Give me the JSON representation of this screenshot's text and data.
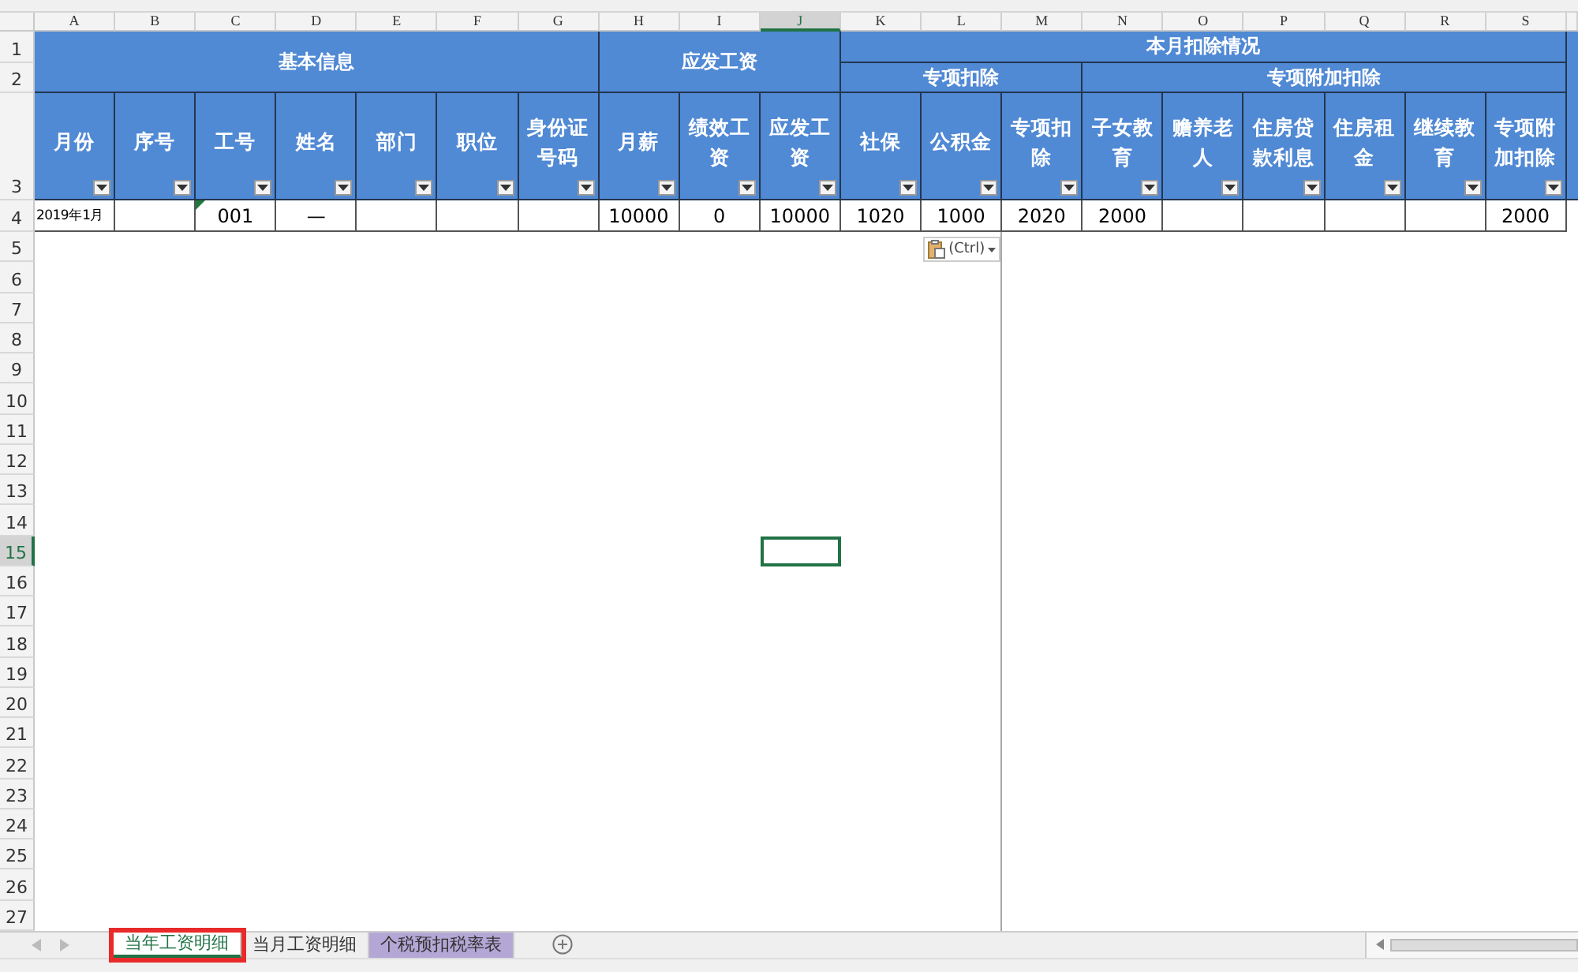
{
  "columns": [
    {
      "label": "A",
      "selected": false
    },
    {
      "label": "B",
      "selected": false
    },
    {
      "label": "C",
      "selected": false
    },
    {
      "label": "D",
      "selected": false
    },
    {
      "label": "E",
      "selected": false
    },
    {
      "label": "F",
      "selected": false
    },
    {
      "label": "G",
      "selected": false
    },
    {
      "label": "H",
      "selected": false
    },
    {
      "label": "I",
      "selected": false
    },
    {
      "label": "J",
      "selected": true
    },
    {
      "label": "K",
      "selected": false
    },
    {
      "label": "L",
      "selected": false
    },
    {
      "label": "M",
      "selected": false
    },
    {
      "label": "N",
      "selected": false
    },
    {
      "label": "O",
      "selected": false
    },
    {
      "label": "P",
      "selected": false
    },
    {
      "label": "Q",
      "selected": false
    },
    {
      "label": "R",
      "selected": false
    },
    {
      "label": "S",
      "selected": false
    }
  ],
  "rows": [
    {
      "label": "1",
      "selected": false
    },
    {
      "label": "2",
      "selected": false
    },
    {
      "label": "3",
      "selected": false
    },
    {
      "label": "4",
      "selected": false
    },
    {
      "label": "5",
      "selected": false
    },
    {
      "label": "6",
      "selected": false
    },
    {
      "label": "7",
      "selected": false
    },
    {
      "label": "8",
      "selected": false
    },
    {
      "label": "9",
      "selected": false
    },
    {
      "label": "10",
      "selected": false
    },
    {
      "label": "11",
      "selected": false
    },
    {
      "label": "12",
      "selected": false
    },
    {
      "label": "13",
      "selected": false
    },
    {
      "label": "14",
      "selected": false
    },
    {
      "label": "15",
      "selected": true
    },
    {
      "label": "16",
      "selected": false
    },
    {
      "label": "17",
      "selected": false
    },
    {
      "label": "18",
      "selected": false
    },
    {
      "label": "19",
      "selected": false
    },
    {
      "label": "20",
      "selected": false
    },
    {
      "label": "21",
      "selected": false
    },
    {
      "label": "22",
      "selected": false
    },
    {
      "label": "23",
      "selected": false
    },
    {
      "label": "24",
      "selected": false
    },
    {
      "label": "25",
      "selected": false
    },
    {
      "label": "26",
      "selected": false
    },
    {
      "label": "27",
      "selected": false
    }
  ],
  "header_groups": [
    {
      "title": "基本信息",
      "fields": [
        {
          "label": "月份",
          "value": "2019年1月"
        },
        {
          "label": "序号"
        },
        {
          "label": "工号",
          "value": "001",
          "error_flag": true
        },
        {
          "label": "姓名",
          "value": "—"
        },
        {
          "label": "部门"
        },
        {
          "label": "职位"
        },
        {
          "label": "身份证号码"
        }
      ]
    },
    {
      "title": "应发工资",
      "fields": [
        {
          "label": "月薪",
          "value": "10000"
        },
        {
          "label": "绩效工资",
          "value": "0"
        },
        {
          "label": "应发工资",
          "value": "10000"
        }
      ]
    },
    {
      "title": "本月扣除情况",
      "subgroups": [
        {
          "title": "专项扣除",
          "fields": [
            {
              "label": "社保",
              "value": "1020"
            },
            {
              "label": "公积金",
              "value": "1000"
            },
            {
              "label": "专项扣除",
              "value": "2020"
            }
          ]
        },
        {
          "title": "专项附加扣除",
          "fields": [
            {
              "label": "子女教育",
              "value": "2000"
            },
            {
              "label": "赡养老人"
            },
            {
              "label": "住房贷款利息"
            },
            {
              "label": "住房租金"
            },
            {
              "label": "继续教育"
            },
            {
              "label": "专项附加扣除",
              "value": "2000"
            }
          ]
        }
      ]
    }
  ],
  "paste_options": {
    "label": "(Ctrl)"
  },
  "sheet_tabs": [
    {
      "label": "当年工资明细",
      "selected": true,
      "annotated": true
    },
    {
      "label": "当月工资明细",
      "selected": false,
      "annotated": false
    },
    {
      "label": "个税预扣税率表",
      "selected": false,
      "annotated": false,
      "color": "#b4a7d6"
    }
  ]
}
